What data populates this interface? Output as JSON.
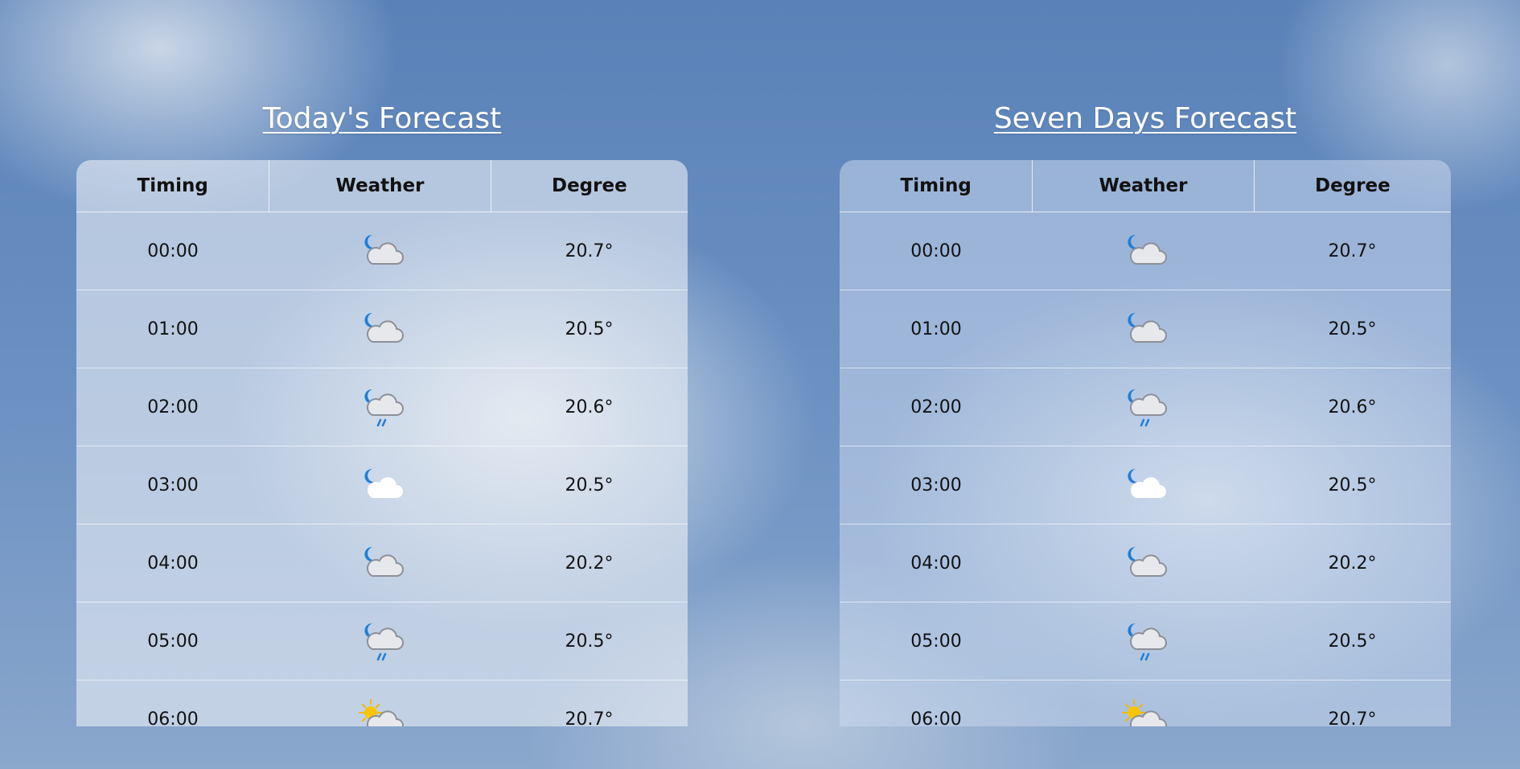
{
  "panels": [
    {
      "title": "Today's Forecast",
      "headers": [
        "Timing",
        "Weather",
        "Degree"
      ],
      "rows": [
        {
          "time": "00:00",
          "icon": "moon-cloud-icon",
          "degree": "20.7°"
        },
        {
          "time": "01:00",
          "icon": "moon-cloud-icon",
          "degree": "20.5°"
        },
        {
          "time": "02:00",
          "icon": "moon-cloud-rain-icon",
          "degree": "20.6°"
        },
        {
          "time": "03:00",
          "icon": "moon-white-cloud-icon",
          "degree": "20.5°"
        },
        {
          "time": "04:00",
          "icon": "moon-cloud-icon",
          "degree": "20.2°"
        },
        {
          "time": "05:00",
          "icon": "moon-cloud-rain-icon",
          "degree": "20.5°"
        },
        {
          "time": "06:00",
          "icon": "sun-cloud-icon",
          "degree": "20.7°"
        }
      ]
    },
    {
      "title": "Seven Days Forecast",
      "headers": [
        "Timing",
        "Weather",
        "Degree"
      ],
      "rows": [
        {
          "time": "00:00",
          "icon": "moon-cloud-icon",
          "degree": "20.7°"
        },
        {
          "time": "01:00",
          "icon": "moon-cloud-icon",
          "degree": "20.5°"
        },
        {
          "time": "02:00",
          "icon": "moon-cloud-rain-icon",
          "degree": "20.6°"
        },
        {
          "time": "03:00",
          "icon": "moon-white-cloud-icon",
          "degree": "20.5°"
        },
        {
          "time": "04:00",
          "icon": "moon-cloud-icon",
          "degree": "20.2°"
        },
        {
          "time": "05:00",
          "icon": "moon-cloud-rain-icon",
          "degree": "20.5°"
        },
        {
          "time": "06:00",
          "icon": "sun-cloud-icon",
          "degree": "20.7°"
        }
      ]
    }
  ]
}
